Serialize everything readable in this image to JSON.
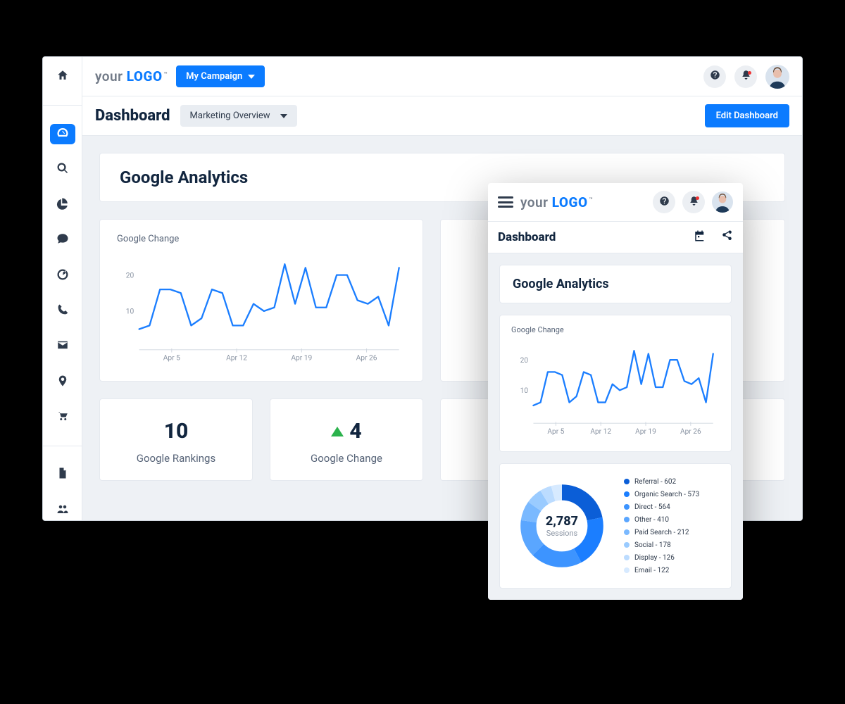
{
  "brand": {
    "your": "your",
    "logo": "LOGO",
    "tm": "™"
  },
  "campaign_button": "My Campaign",
  "header": {
    "title": "Dashboard",
    "dropdown": "Marketing Overview",
    "edit_button": "Edit Dashboard"
  },
  "section_title": "Google Analytics",
  "chart_title": "Google Change",
  "stats": {
    "rankings": {
      "value": "10",
      "label": "Google Rankings"
    },
    "change": {
      "value": "4",
      "label": "Google Change"
    }
  },
  "mobile": {
    "title": "Dashboard",
    "section_title": "Google Analytics",
    "chart_title": "Google Change",
    "donut": {
      "total": "2,787",
      "sub": "Sessions",
      "items": [
        {
          "label": "Referral - 602",
          "color": "#0b5ed7"
        },
        {
          "label": "Organic Search - 573",
          "color": "#1b7eff"
        },
        {
          "label": "Direct - 564",
          "color": "#3d94ff"
        },
        {
          "label": "Other - 410",
          "color": "#5aa6ff"
        },
        {
          "label": "Paid Search - 212",
          "color": "#7ab9ff"
        },
        {
          "label": "Social - 178",
          "color": "#9acbff"
        },
        {
          "label": "Display - 126",
          "color": "#bcdcff"
        },
        {
          "label": "Email - 122",
          "color": "#d7eaff"
        }
      ]
    }
  },
  "chart_data": [
    {
      "type": "line",
      "title": "Google Change",
      "ylim": [
        0,
        24
      ],
      "yticks": [
        10,
        20
      ],
      "xticks": [
        "Apr 5",
        "Apr 12",
        "Apr 19",
        "Apr 26"
      ],
      "x": [
        0,
        1,
        2,
        3,
        4,
        5,
        6,
        7,
        8,
        9,
        10,
        11,
        12,
        13,
        14,
        15,
        16,
        17,
        18,
        19,
        20,
        21,
        22,
        23,
        24,
        25
      ],
      "values": [
        5,
        6,
        16,
        16,
        15,
        6,
        8,
        16,
        15,
        6,
        6,
        12,
        10,
        11,
        23,
        12,
        22,
        11,
        11,
        20,
        20,
        13,
        12,
        14,
        6,
        22
      ]
    },
    {
      "type": "pie",
      "title": "Sessions",
      "total": 2787,
      "series": [
        {
          "name": "Referral",
          "value": 602
        },
        {
          "name": "Organic Search",
          "value": 573
        },
        {
          "name": "Direct",
          "value": 564
        },
        {
          "name": "Other",
          "value": 410
        },
        {
          "name": "Paid Search",
          "value": 212
        },
        {
          "name": "Social",
          "value": 178
        },
        {
          "name": "Display",
          "value": 126
        },
        {
          "name": "Email",
          "value": 122
        }
      ]
    }
  ]
}
